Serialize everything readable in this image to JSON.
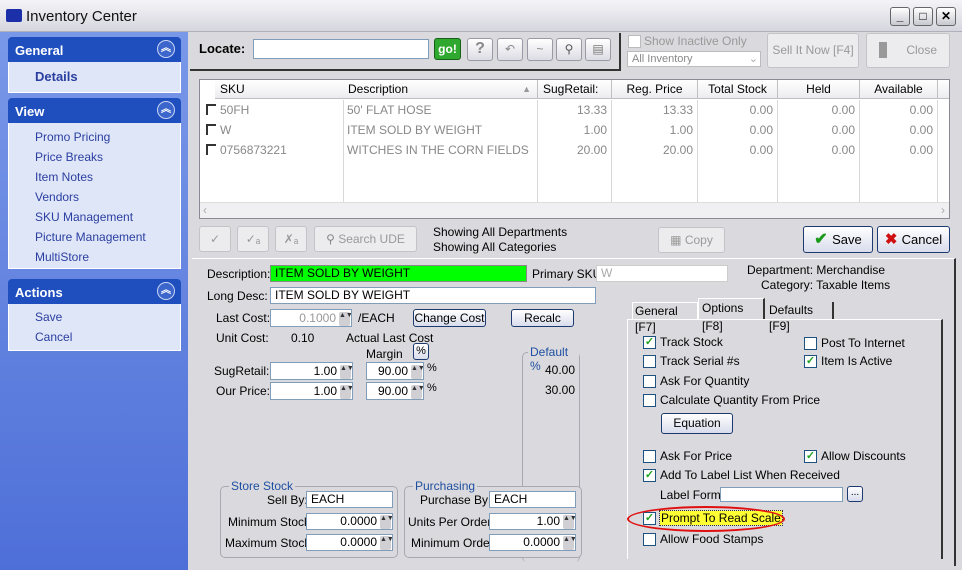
{
  "window": {
    "title": "Inventory Center",
    "controls": [
      "minimize",
      "maximize",
      "close"
    ]
  },
  "sidebar": {
    "general": {
      "title": "General",
      "items": [
        "Details"
      ]
    },
    "view": {
      "title": "View",
      "items": [
        "Promo Pricing",
        "Price Breaks",
        "Item Notes",
        "Vendors",
        "SKU Management",
        "Picture Management",
        "MultiStore"
      ]
    },
    "actions": {
      "title": "Actions",
      "items": [
        "Save",
        "Cancel"
      ]
    }
  },
  "locate": {
    "label": "Locate:",
    "value": "",
    "go": "go!",
    "show_inactive": "Show Inactive Only",
    "show_inactive_checked": false,
    "filter": "All Inventory",
    "sell_it_now": "Sell It Now [F4]",
    "close": "Close"
  },
  "grid": {
    "columns": [
      "SKU",
      "Description",
      "SugRetail:",
      "Reg. Price",
      "Total Stock",
      "Held",
      "Available"
    ],
    "rows": [
      {
        "sku": "50FH",
        "desc": "50' FLAT HOSE",
        "sug": "13.33",
        "reg": "13.33",
        "total": "0.00",
        "held": "0.00",
        "avail": "0.00"
      },
      {
        "sku": "W",
        "desc": "ITEM SOLD BY WEIGHT",
        "sug": "1.00",
        "reg": "1.00",
        "total": "0.00",
        "held": "0.00",
        "avail": "0.00"
      },
      {
        "sku": "0756873221",
        "desc": "WITCHES IN THE CORN FIELDS",
        "sug": "20.00",
        "reg": "20.00",
        "total": "0.00",
        "held": "0.00",
        "avail": "0.00"
      }
    ]
  },
  "toolbar": {
    "search_ude": "Search UDE",
    "showing_dept": "Showing All Departments",
    "showing_cat": "Showing All Categories",
    "copy": "Copy",
    "save": "Save",
    "cancel": "Cancel"
  },
  "detail": {
    "description_label": "Description:",
    "description": "ITEM SOLD BY WEIGHT",
    "description_bg": "#00ff00",
    "primary_sku_label": "Primary SKU:",
    "primary_sku": "W",
    "long_desc_label": "Long Desc:",
    "long_desc": "ITEM SOLD BY WEIGHT",
    "last_cost_label": "Last Cost:",
    "last_cost": "0.1000",
    "per_unit": "/EACH",
    "change_cost": "Change Cost",
    "recalc": "Recalc",
    "unit_cost_label": "Unit Cost:",
    "unit_cost": "0.10",
    "actual_last_cost": "Actual Last Cost",
    "margin_label": "Margin",
    "pct_btn": "%",
    "sug_retail_label": "SugRetail:",
    "sug_retail": "1.00",
    "sug_margin": "90.00",
    "our_price_label": "Our Price:",
    "our_price": "1.00",
    "our_margin": "90.00",
    "pct": "%",
    "default_pct_title": "Default %",
    "default_sug": "40.00",
    "default_our": "30.00",
    "department": "Department: Merchandise",
    "category": "Category: Taxable Items",
    "store_stock": {
      "title": "Store Stock",
      "sell_by_label": "Sell By:",
      "sell_by": "EACH",
      "min_label": "Minimum Stock:",
      "min": "0.0000",
      "max_label": "Maximum Stock:",
      "max": "0.0000"
    },
    "purchasing": {
      "title": "Purchasing",
      "purchase_by_label": "Purchase By:",
      "purchase_by": "EACH",
      "units_label": "Units Per Order:",
      "units": "1.00",
      "min_order_label": "Minimum Order:",
      "min_order": "0.0000"
    }
  },
  "tabs": [
    "General [F7]",
    "Options [F8]",
    "Defaults [F9]"
  ],
  "active_tab": "Options [F8]",
  "options": {
    "track_stock": {
      "label": "Track Stock",
      "checked": true
    },
    "track_serial": {
      "label": "Track Serial #s",
      "checked": false
    },
    "ask_qty": {
      "label": "Ask For Quantity",
      "checked": false
    },
    "calc_qty": {
      "label": "Calculate Quantity From Price",
      "checked": false
    },
    "equation": "Equation",
    "post_internet": {
      "label": "Post To Internet",
      "checked": false
    },
    "item_active": {
      "label": "Item Is Active",
      "checked": true
    },
    "ask_price": {
      "label": "Ask For Price",
      "checked": false
    },
    "allow_discounts": {
      "label": "Allow Discounts",
      "checked": true
    },
    "add_label": {
      "label": "Add To Label List When Received",
      "checked": true
    },
    "label_form_label": "Label Form:",
    "label_form": "",
    "browse": "...",
    "prompt_scale": {
      "label": "Prompt To Read Scale",
      "checked": true
    },
    "food_stamps": {
      "label": "Allow Food Stamps",
      "checked": false
    },
    "highlight_color": "#ffff33",
    "circle_color": "#e01010"
  }
}
